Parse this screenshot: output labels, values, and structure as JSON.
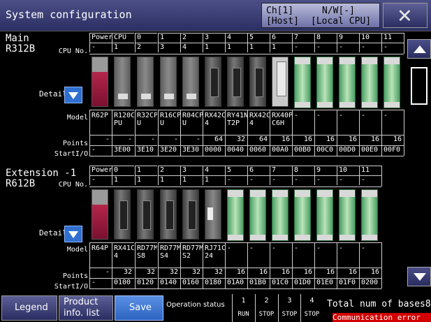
{
  "title": "System configuration",
  "channel": {
    "line1_left": "Ch[1]",
    "line1_right": "N/W[-]",
    "line2_left": "[Host]",
    "line2_right": "[Local CPU]"
  },
  "close_glyph": "✕",
  "labels": {
    "cpu_no": "CPU No.",
    "model": "Model",
    "points": "Points",
    "start_io": "StartI/O",
    "detail": "Detail"
  },
  "main": {
    "name_line1": "Main",
    "name_line2": "R312B",
    "headers": [
      "Power",
      "CPU",
      "0",
      "1",
      "2",
      "3",
      "4",
      "5",
      "6",
      "7",
      "8",
      "9",
      "10",
      "11"
    ],
    "cpu_no": [
      "-",
      "1",
      "2",
      "3",
      "4",
      "1",
      "1",
      "1",
      "1",
      "-",
      "-",
      "-",
      "-",
      "-"
    ],
    "models": [
      [
        "R62P",
        ""
      ],
      [
        "R120C",
        "PU"
      ],
      [
        "R32CP",
        "U"
      ],
      [
        "R16CP",
        "U"
      ],
      [
        "R04CP",
        "U"
      ],
      [
        "RX42C",
        "4"
      ],
      [
        "RY41N",
        "T2P"
      ],
      [
        "RX42C",
        "4"
      ],
      [
        "RX40P",
        "C6H"
      ],
      [
        "-",
        ""
      ],
      [
        "-",
        ""
      ],
      [
        "-",
        ""
      ],
      [
        "-",
        ""
      ],
      [
        "-",
        ""
      ]
    ],
    "points": [
      "-",
      "-",
      "-",
      "-",
      "-",
      "64",
      "32",
      "64",
      "16",
      "16",
      "16",
      "16",
      "16",
      "16"
    ],
    "start_io": [
      "-",
      "3E00",
      "3E10",
      "3E20",
      "3E30",
      "0000",
      "0040",
      "0060",
      "00A0",
      "00B0",
      "00C0",
      "00D0",
      "00E0",
      "00F0"
    ],
    "module_types": [
      "psu",
      "cpu",
      "cpu",
      "cpu",
      "cpu",
      "io",
      "io",
      "io",
      "rx40",
      "empty",
      "empty",
      "empty",
      "empty",
      "empty"
    ]
  },
  "ext": {
    "name_line1": "Extension -1",
    "name_line2": "R612B",
    "headers": [
      "Power",
      "0",
      "1",
      "2",
      "3",
      "4",
      "5",
      "6",
      "7",
      "8",
      "9",
      "10",
      "11"
    ],
    "cpu_no": [
      "-",
      "1",
      "1",
      "1",
      "1",
      "1",
      "-",
      "-",
      "-",
      "-",
      "-",
      "-",
      "-"
    ],
    "models": [
      [
        "R64P",
        ""
      ],
      [
        "RX41C",
        "4"
      ],
      [
        "RD77M",
        "S8"
      ],
      [
        "RD77M",
        "S4"
      ],
      [
        "RD77M",
        "S2"
      ],
      [
        "RJ71C",
        "24"
      ],
      [
        "-",
        ""
      ],
      [
        "-",
        ""
      ],
      [
        "-",
        ""
      ],
      [
        "-",
        ""
      ],
      [
        "-",
        ""
      ],
      [
        "-",
        ""
      ],
      [
        "-",
        ""
      ]
    ],
    "points": [
      "-",
      "32",
      "32",
      "32",
      "32",
      "32",
      "16",
      "16",
      "16",
      "16",
      "16",
      "16",
      "16"
    ],
    "start_io": [
      "-",
      "0100",
      "0120",
      "0140",
      "0160",
      "0180",
      "01A0",
      "01B0",
      "01C0",
      "01D0",
      "01E0",
      "01F0",
      "0200"
    ],
    "module_types": [
      "psu",
      "io",
      "io",
      "io",
      "io",
      "rj",
      "empty",
      "empty",
      "empty",
      "empty",
      "empty",
      "empty",
      "empty"
    ]
  },
  "footer": {
    "legend": "Legend",
    "product_line1": "Product",
    "product_line2": "info. list",
    "save": "Save",
    "operation_status": "Operation status",
    "op_numbers": [
      "1",
      "2",
      "3",
      "4"
    ],
    "op_states": [
      "RUN",
      "STOP",
      "STOP",
      "STOP"
    ],
    "total": "Total num of bases8",
    "comm_error": "Communication error"
  }
}
